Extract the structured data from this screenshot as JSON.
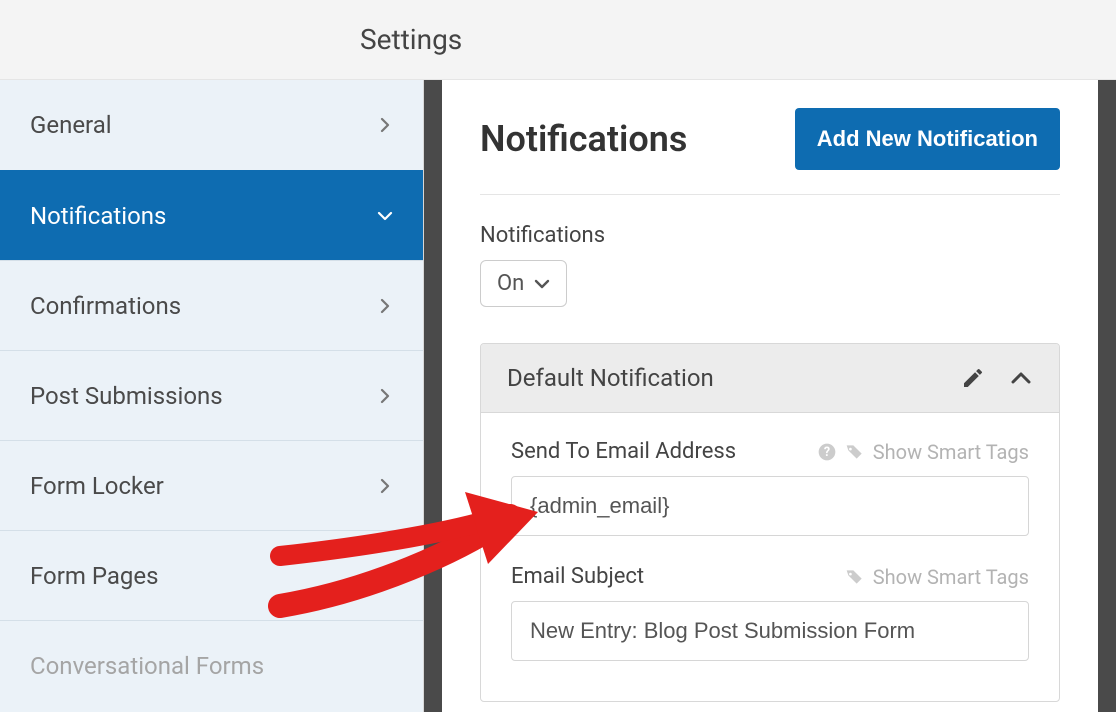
{
  "header": {
    "title": "Settings"
  },
  "sidebar": {
    "items": [
      {
        "label": "General"
      },
      {
        "label": "Notifications",
        "active": true
      },
      {
        "label": "Confirmations"
      },
      {
        "label": "Post Submissions"
      },
      {
        "label": "Form Locker"
      },
      {
        "label": "Form Pages"
      },
      {
        "label": "Conversational Forms",
        "disabled": true
      }
    ]
  },
  "main": {
    "title": "Notifications",
    "add_button": "Add New Notification",
    "state_label": "Notifications",
    "state_value": "On",
    "card": {
      "title": "Default Notification",
      "send_to_label": "Send To Email Address",
      "send_to_value": "{admin_email}",
      "show_smart_tags": "Show Smart Tags",
      "subject_label": "Email Subject",
      "subject_value": "New Entry: Blog Post Submission Form"
    }
  }
}
